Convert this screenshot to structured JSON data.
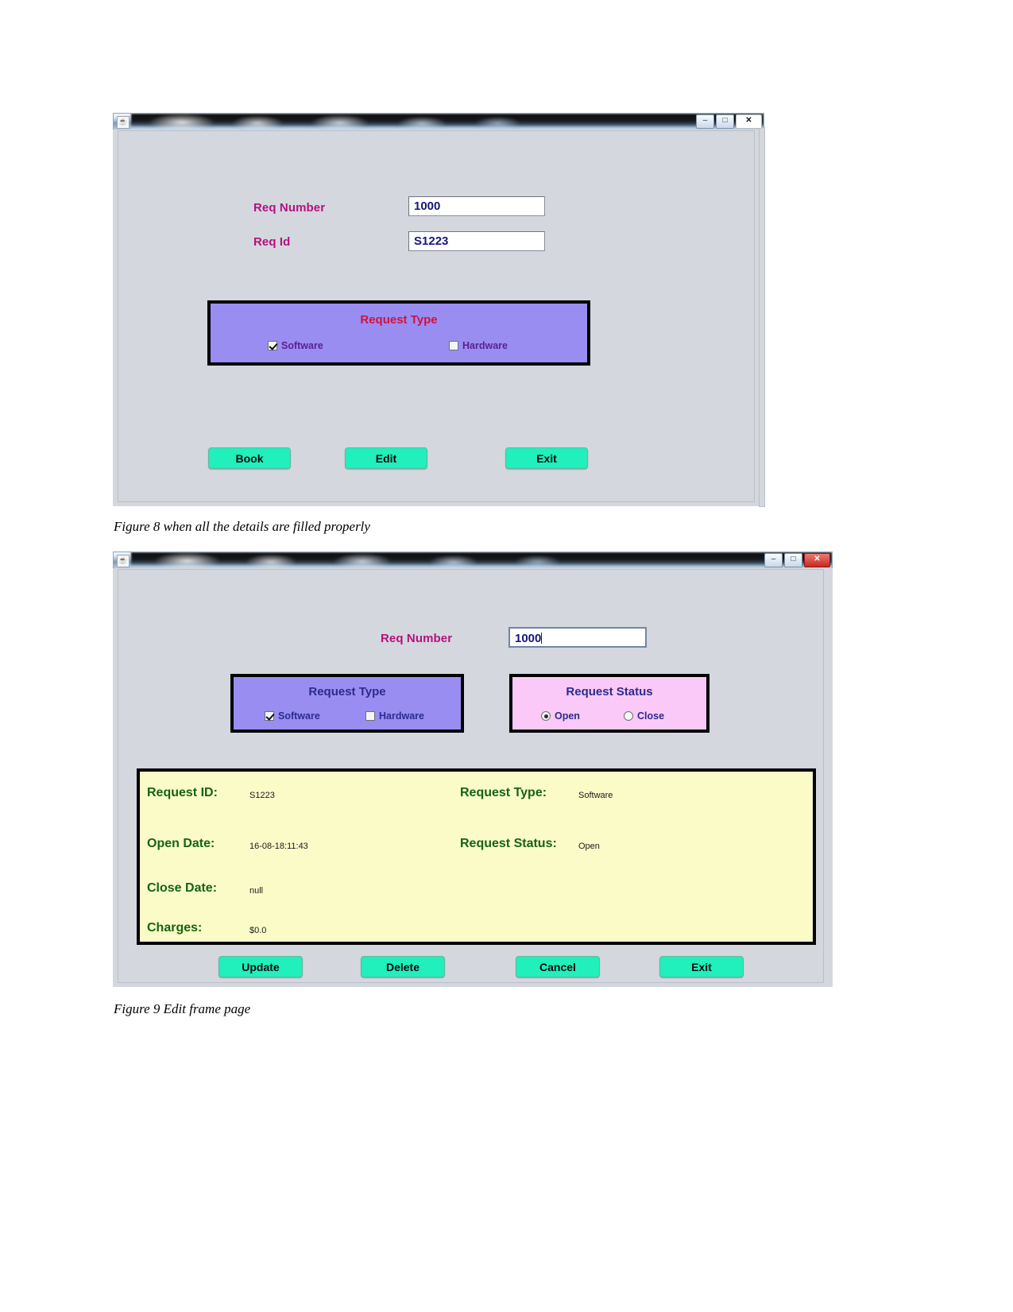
{
  "figure8": {
    "window": {
      "title": "",
      "icon": "java-coffee-cup-icon",
      "caption_buttons": [
        {
          "name": "minimize-button",
          "glyph": "–"
        },
        {
          "name": "maximize-button",
          "glyph": "□"
        },
        {
          "name": "close-button",
          "glyph": "✕"
        }
      ]
    },
    "fields": [
      {
        "label": "Req Number",
        "value": "1000"
      },
      {
        "label": "Req Id",
        "value": "S1223"
      }
    ],
    "request_type_panel": {
      "title": "Request Type",
      "title_color": "#d0123f",
      "background": "#9a8df2",
      "options": [
        {
          "label": "Software",
          "checked": true
        },
        {
          "label": "Hardware",
          "checked": false
        }
      ]
    },
    "buttons": [
      {
        "label": "Book"
      },
      {
        "label": "Edit"
      },
      {
        "label": "Exit"
      }
    ],
    "caption": "Figure 8 when all the details are filled properly"
  },
  "figure9": {
    "window": {
      "title": "",
      "icon": "java-coffee-cup-icon",
      "caption_buttons": [
        {
          "name": "minimize-button",
          "glyph": "–"
        },
        {
          "name": "maximize-button",
          "glyph": "□"
        },
        {
          "name": "close-button",
          "glyph": "✕"
        }
      ]
    },
    "fields": [
      {
        "label": "Req Number",
        "value": "1000"
      }
    ],
    "request_type_panel": {
      "title": "Request Type",
      "title_color": "#2b2b8f",
      "background": "#9a8df2",
      "options": [
        {
          "label": "Software",
          "checked": true
        },
        {
          "label": "Hardware",
          "checked": false
        }
      ]
    },
    "request_status_panel": {
      "title": "Request Status",
      "title_color": "#2b2b8f",
      "background": "#fbc9f7",
      "options": [
        {
          "label": "Open",
          "selected": true
        },
        {
          "label": "Close",
          "selected": false
        }
      ]
    },
    "details": {
      "background": "#fbfbc8",
      "label_color": "#166316",
      "rows": [
        {
          "label": "Request ID:",
          "value": "S1223"
        },
        {
          "label": "Request Type:",
          "value": "Software"
        },
        {
          "label": "Open Date:",
          "value": "16-08-18:11:43"
        },
        {
          "label": "Request Status:",
          "value": "Open"
        },
        {
          "label": "Close Date:",
          "value": "null"
        },
        {
          "label": "Charges:",
          "value": "$0.0"
        }
      ]
    },
    "buttons": [
      {
        "label": "Update"
      },
      {
        "label": "Delete"
      },
      {
        "label": "Cancel"
      },
      {
        "label": "Exit"
      }
    ],
    "caption": "Figure 9 Edit frame page"
  }
}
